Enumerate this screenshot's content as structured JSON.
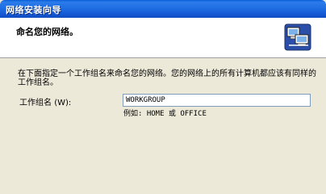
{
  "window": {
    "title": "网络安装向导"
  },
  "header": {
    "title": "命名您的网络。",
    "icon": "network-computers-icon"
  },
  "body": {
    "instruction": "在下面指定一个工作组名来命名您的网络。您的网络上的所有计算机都应该有同样的工作组名。",
    "workgroup_label": "工作组名",
    "workgroup_accel": "(W):",
    "workgroup_value": "WORKGROUP",
    "example": "例如: HOME 或 OFFICE"
  }
}
